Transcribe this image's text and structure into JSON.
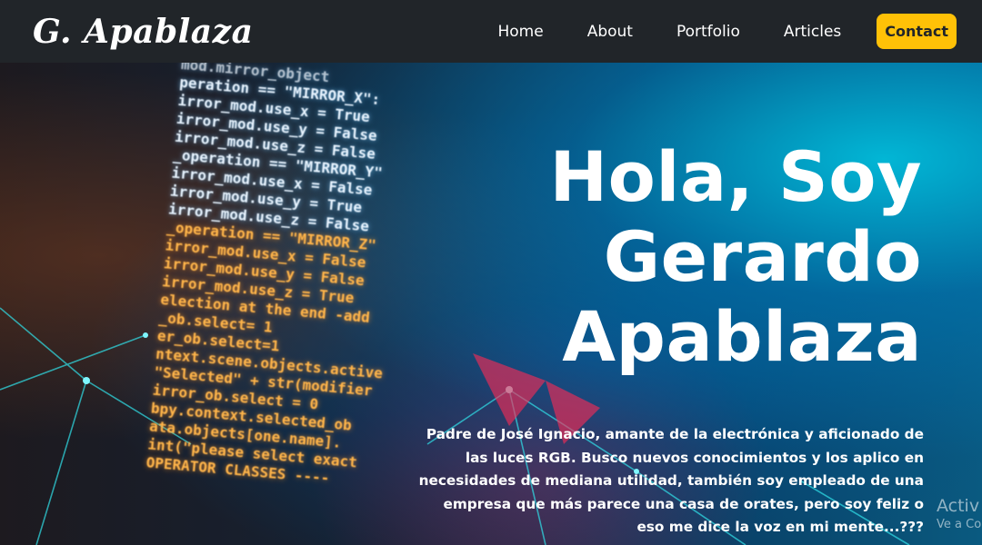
{
  "navbar": {
    "brand": "G. Apablaza",
    "links": [
      "Home",
      "About",
      "Portfolio",
      "Articles"
    ],
    "contact_label": "Contact",
    "contact_color": "#ffc107",
    "background": "#212529"
  },
  "hero": {
    "title_lines": [
      "Hola, Soy",
      "Gerardo",
      "Apablaza"
    ],
    "bio": "Padre de José Ignacio, amante de la electrónica y aficionado de las luces RGB. Busco nuevos conocimientos y los aplico en necesidades de mediana utilidad, también soy empleado de una empresa que más parece una casa de orates, pero soy feliz o eso me dice la voz en mi mente...???",
    "code_lines": [
      "mod.mirror_object",
      "peration == \"MIRROR_X\":",
      "irror_mod.use_x = True",
      "irror_mod.use_y = False",
      "irror_mod.use_z = False",
      "_operation == \"MIRROR_Y\"",
      "irror_mod.use_x = False",
      "irror_mod.use_y = True",
      "irror_mod.use_z = False",
      "_operation == \"MIRROR_Z\"",
      "irror_mod.use_x = False",
      "irror_mod.use_y = False",
      "irror_mod.use_z = True",
      "",
      "election at the end -add",
      "_ob.select= 1",
      "er_ob.select=1",
      "ntext.scene.objects.active",
      "\"Selected\" + str(modifier",
      "irror_ob.select = 0",
      "bpy.context.selected_ob",
      "ata.objects[one.name].",
      "",
      "int(\"please select exact",
      "",
      "OPERATOR CLASSES ----"
    ]
  },
  "watermark": {
    "line1": "Activ",
    "line2": "Ve a Co"
  }
}
